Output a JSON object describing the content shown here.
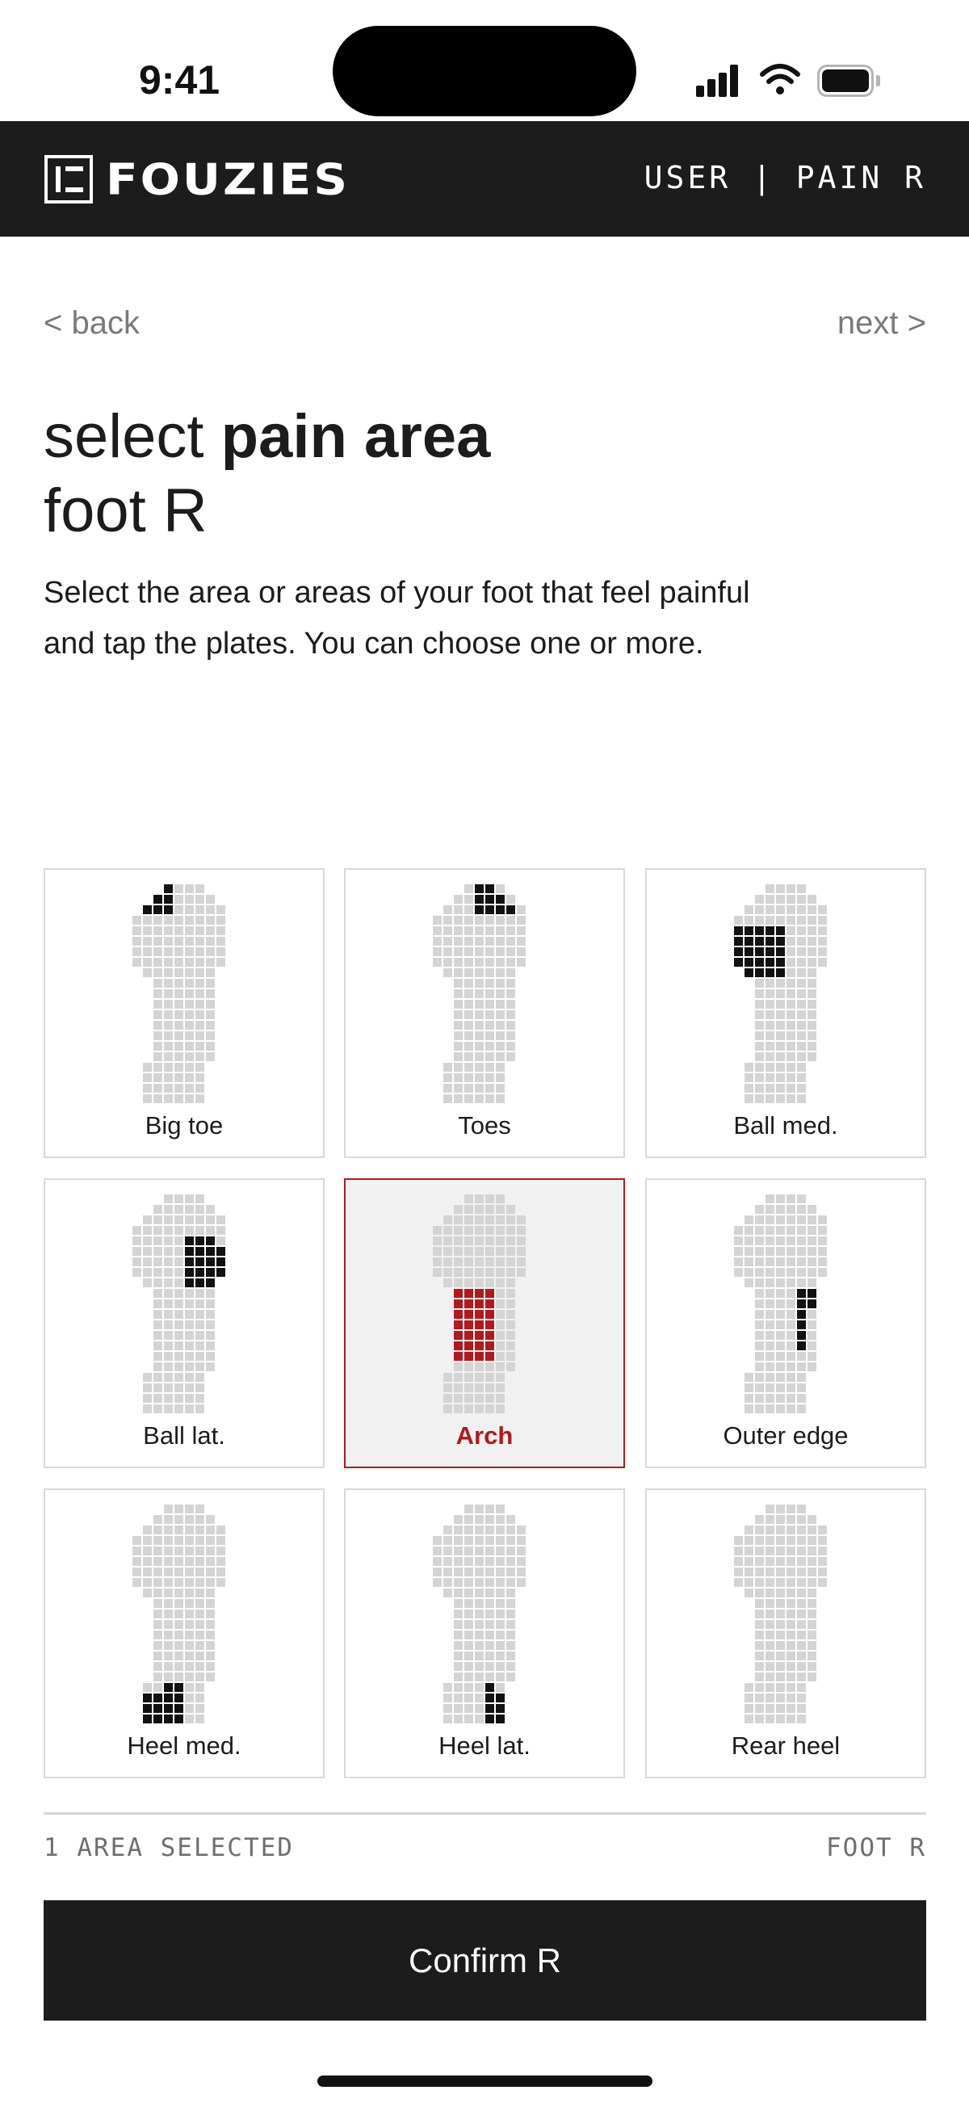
{
  "status_bar": {
    "time": "9:41"
  },
  "header": {
    "logo_text": "FOUZIES",
    "context": "USER | PAIN R"
  },
  "nav": {
    "back_label": "< back",
    "next_label": "next >"
  },
  "title": {
    "prefix": "select ",
    "bold": "pain area",
    "line2": "foot R"
  },
  "description": "Select the area or areas of your foot that feel painful and tap the plates. You can choose one or more.",
  "plates": [
    {
      "id": "big-toe",
      "label": "Big toe",
      "selected": false
    },
    {
      "id": "toes",
      "label": "Toes",
      "selected": false
    },
    {
      "id": "ball-med",
      "label": "Ball med.",
      "selected": false
    },
    {
      "id": "ball-lat",
      "label": "Ball lat.",
      "selected": false
    },
    {
      "id": "arch",
      "label": "Arch",
      "selected": true
    },
    {
      "id": "outer-edge",
      "label": "Outer edge",
      "selected": false
    },
    {
      "id": "heel-med",
      "label": "Heel med.",
      "selected": false
    },
    {
      "id": "heel-lat",
      "label": "Heel lat.",
      "selected": false
    },
    {
      "id": "rear-heel",
      "label": "Rear heel",
      "selected": false
    }
  ],
  "footer": {
    "selection_count": "1 AREA SELECTED",
    "foot_label": "FOOT R",
    "confirm_label": "Confirm R"
  },
  "colors": {
    "dark": "#1c1c1c",
    "accent": "#b3191c",
    "dot_inactive": "#d4d4d4",
    "dot_active": "#111111"
  }
}
